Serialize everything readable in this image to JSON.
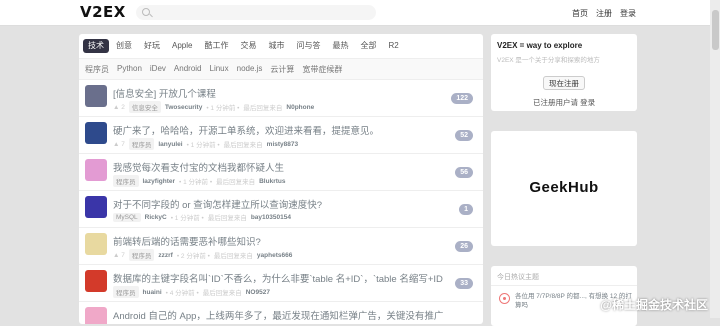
{
  "header": {
    "logo": "V2EX",
    "search_placeholder": "",
    "nav": [
      "首页",
      "注册",
      "登录"
    ]
  },
  "tabs": [
    "技术",
    "创意",
    "好玩",
    "Apple",
    "酷工作",
    "交易",
    "城市",
    "问与答",
    "最热",
    "全部",
    "R2"
  ],
  "active_tab": "技术",
  "subtabs": [
    "程序员",
    "Python",
    "iDev",
    "Android",
    "Linux",
    "node.js",
    "云计算",
    "宽带症候群"
  ],
  "topics": [
    {
      "title": "[信息安全] 开放几个课程",
      "votes": "▲ 2",
      "node": "信息安全",
      "author": "Twosecurity",
      "time": "• 1 分钟前 •",
      "last_label": "最后回复来自",
      "last": "N0phone",
      "count": "122",
      "avatar_color": "#6a6f8c"
    },
    {
      "title": "硬广来了，哈哈哈，开源工单系统，欢迎进来看看，提提意见。",
      "votes": "▲ 7",
      "node": "程序员",
      "author": "lanyulei",
      "time": "• 1 分钟前 •",
      "last_label": "最后回复来自",
      "last": "misty8873",
      "count": "52",
      "avatar_color": "#2e4a8c"
    },
    {
      "title": "我感觉每次看支付宝的文档我都怀疑人生",
      "votes": "",
      "node": "程序员",
      "author": "lazyfighter",
      "time": "• 1 分钟前 •",
      "last_label": "最后回复来自",
      "last": "Blukrtus",
      "count": "56",
      "avatar_color": "#e39bd3"
    },
    {
      "title": "对于不同字段的 or 查询怎样建立所以查询速度快?",
      "votes": "",
      "node": "MySQL",
      "author": "RickyC",
      "time": "• 1 分钟前 •",
      "last_label": "最后回复来自",
      "last": "bay10350154",
      "count": "1",
      "avatar_color": "#3a35a8"
    },
    {
      "title": "前端转后端的话需要恶补哪些知识?",
      "votes": "▲ 7",
      "node": "程序员",
      "author": "zzzrf",
      "time": "• 2 分钟前 •",
      "last_label": "最后回复来自",
      "last": "yaphets666",
      "count": "26",
      "avatar_color": "#e8d9a0"
    },
    {
      "title": "数据库的主键字段名叫`ID`不香么，为什么非要`table 名+ID`，`table 名缩写+ID`?",
      "votes": "",
      "node": "程序员",
      "author": "huaini",
      "time": "• 4 分钟前 •",
      "last_label": "最后回复来自",
      "last": "NO9527",
      "count": "33",
      "avatar_color": "#d33a2a"
    },
    {
      "title": "Android 自己的 App，上线两年多了，最近发现在通知栏弹广告，关键没有推广告 sdk，",
      "votes": "",
      "node": "",
      "author": "",
      "time": "",
      "last_label": "",
      "last": "",
      "count": "",
      "avatar_color": "#f0a8c8"
    }
  ],
  "sidebar": {
    "title": "V2EX = way to explore",
    "subtitle": "V2EX 是一个关于分享和探索的地方",
    "signup_button": "现在注册",
    "login_prefix": "已注册用户请",
    "login_link": "登录",
    "ad_text": "GeekHub",
    "hot_header": "今日热议主题",
    "hot_item": "各位用 7/7P/8/8P 的都..., 有想换 12 的打算吗"
  },
  "watermark": "@稀土掘金技术社区"
}
